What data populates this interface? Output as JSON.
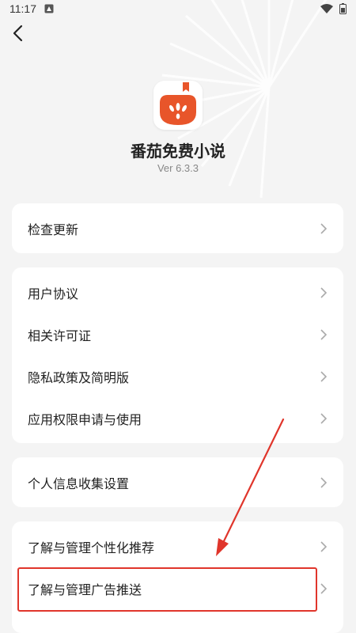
{
  "status_bar": {
    "time": "11:17"
  },
  "app": {
    "name": "番茄免费小说",
    "version": "Ver 6.3.3",
    "icon": "tomato-book-icon",
    "accent_color": "#e8552a"
  },
  "groups": [
    {
      "items": [
        {
          "label": "检查更新"
        }
      ]
    },
    {
      "items": [
        {
          "label": "用户协议"
        },
        {
          "label": "相关许可证"
        },
        {
          "label": "隐私政策及简明版"
        },
        {
          "label": "应用权限申请与使用"
        }
      ]
    },
    {
      "items": [
        {
          "label": "个人信息收集设置"
        }
      ]
    },
    {
      "items": [
        {
          "label": "了解与管理个性化推荐"
        },
        {
          "label": "了解与管理广告推送"
        }
      ]
    }
  ],
  "annotation_color": "#e0352b"
}
